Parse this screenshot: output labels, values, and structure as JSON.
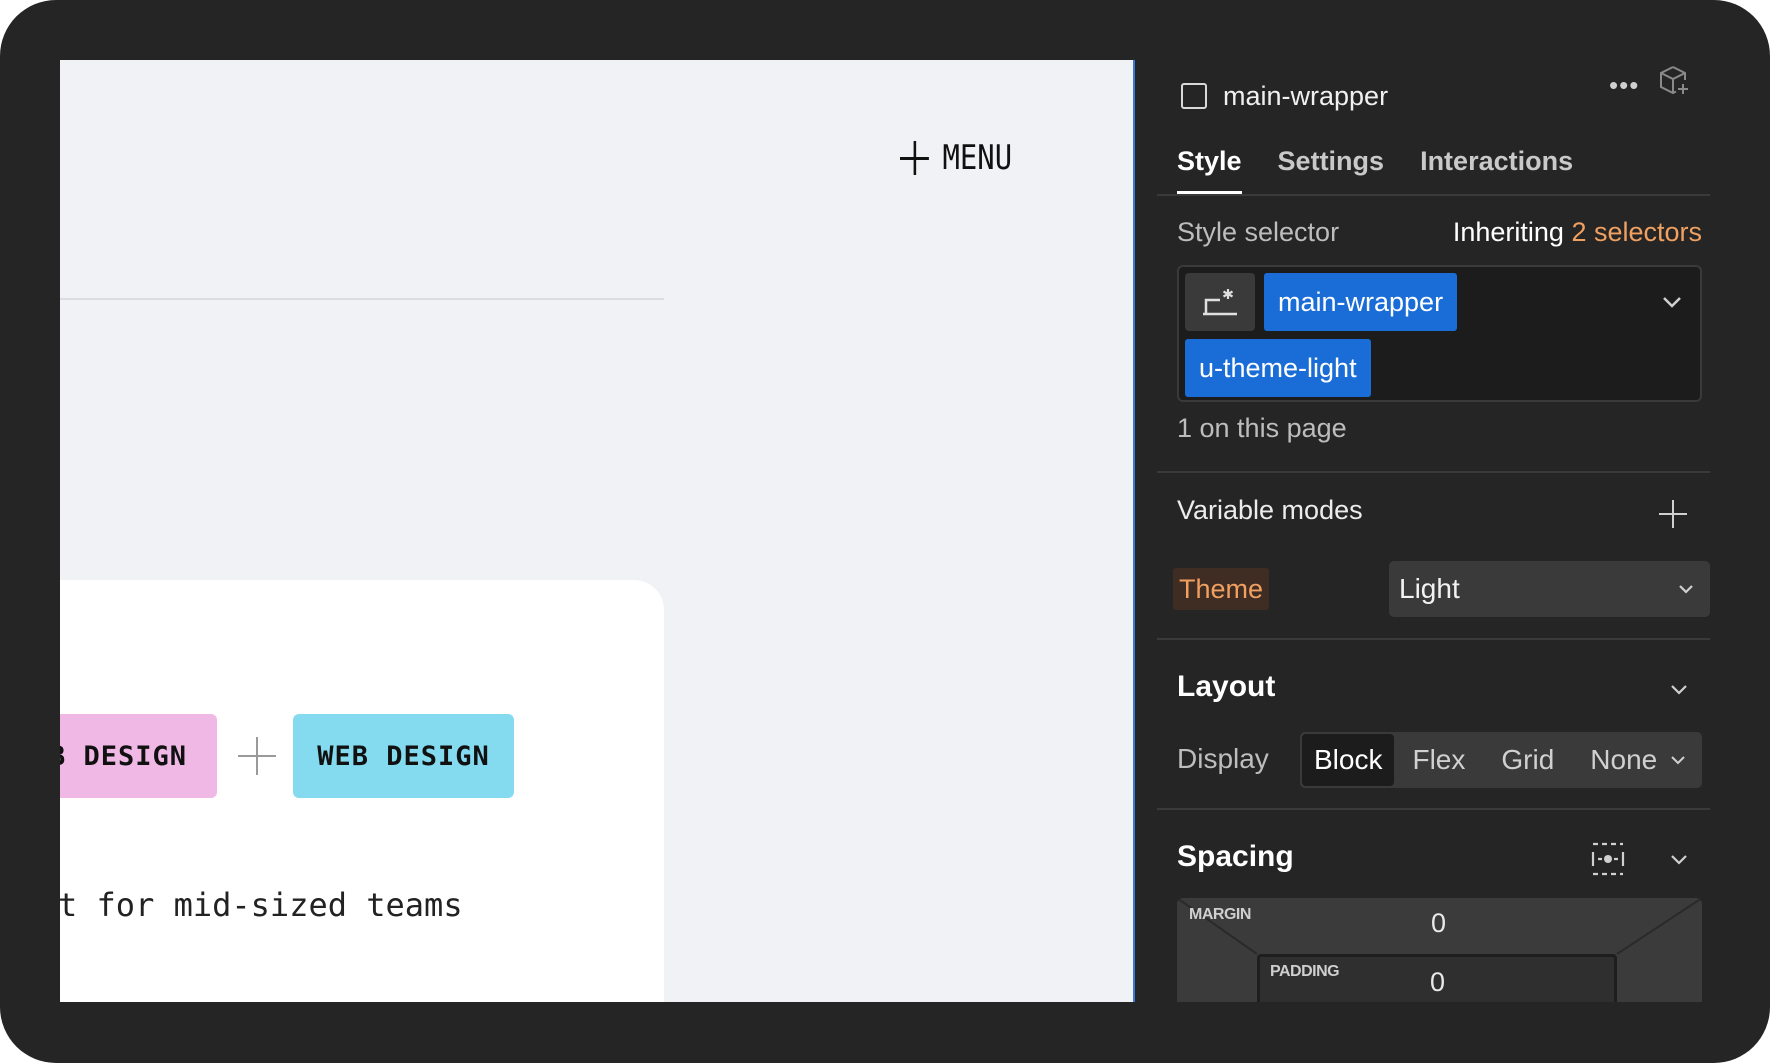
{
  "canvas": {
    "menu_label": "MENU",
    "tags": [
      "B DESIGN",
      "WEB DESIGN"
    ],
    "card_text": "t for mid-sized teams"
  },
  "panel": {
    "element_name": "main-wrapper",
    "more_icon": "more-horizontal-icon",
    "component_icon": "component-add-icon",
    "tabs": [
      {
        "label": "Style",
        "active": true
      },
      {
        "label": "Settings",
        "active": false
      },
      {
        "label": "Interactions",
        "active": false
      }
    ],
    "style_selector": {
      "label": "Style selector",
      "inheriting_prefix": "Inheriting",
      "inheriting_count": "2 selectors",
      "chips": [
        "main-wrapper",
        "u-theme-light"
      ],
      "count_text": "1 on this page"
    },
    "variable_modes": {
      "title": "Variable modes",
      "theme_label": "Theme",
      "theme_value": "Light"
    },
    "layout": {
      "title": "Layout",
      "display_label": "Display",
      "options": [
        "Block",
        "Flex",
        "Grid",
        "None"
      ],
      "selected": "Block"
    },
    "spacing": {
      "title": "Spacing",
      "margin_label": "MARGIN",
      "margin_value": "0",
      "padding_label": "PADDING",
      "padding_value": "0"
    }
  },
  "colors": {
    "accent_blue": "#1a6dd6",
    "highlight_orange": "#f0a060",
    "tag_pink": "#f0b8e4",
    "tag_blue": "#84dbf0"
  }
}
